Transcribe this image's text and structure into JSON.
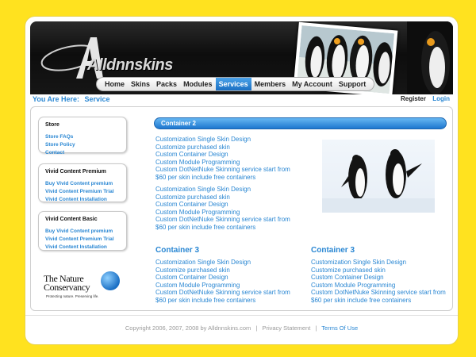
{
  "brand": {
    "logo_text": "Alldnnskins"
  },
  "nav": {
    "items": [
      "Home",
      "Skins",
      "Packs",
      "Modules",
      "Services",
      "Members",
      "My Account",
      "Support"
    ],
    "active": "Services"
  },
  "breadcrumb": {
    "label": "You Are Here:",
    "current": "Service"
  },
  "user": {
    "register": "Register",
    "login": "Login"
  },
  "sidebar": {
    "store": {
      "title": "Store",
      "links": [
        "Store FAQs",
        "Store Policy",
        "Contact"
      ]
    },
    "premium": {
      "title": "Vivid Content Premium",
      "links": [
        "Buy Vivid Content premium",
        "Vivid Content Premium Trial",
        "Vivid Content Installation"
      ]
    },
    "basic": {
      "title": "Vivid Content Basic",
      "links": [
        "Buy Vivid Content premium",
        "Vivid Content Premium Trial",
        "Vivid Content Installation"
      ]
    },
    "nature": {
      "line1": "The Nature",
      "line2": "Conservancy",
      "tagline": "Protecting nature. Preserving life."
    }
  },
  "main": {
    "container2_title": "Container 2",
    "block1": [
      "Customization Single Skin Design",
      "Customize purchased skin",
      "Custom Container Design",
      "Custom Module Programming",
      "Custom DotNetNuke Skinning service start from",
      "$60 per skin include free containers"
    ],
    "block2": [
      "Customization Single Skin Design",
      "Customize purchased skin",
      "Custom Container Design",
      "Custom Module Programming",
      "Custom DotNetNuke Skinning service start from",
      "$60 per skin include free containers"
    ],
    "container3_left_title": "Container 3",
    "block3": [
      "Customization Single Skin Design",
      "Customize purchased skin",
      "Custom Container Design",
      "Custom Module Programming",
      "Custom DotNetNuke Skinning service start from",
      "$60 per skin include free containers"
    ],
    "container3_right_title": "Container 3",
    "block4": [
      "Customization Single Skin Design",
      "Customize purchased skin",
      "Custom Container Design",
      "Custom Module Programming",
      "Custom DotNetNuke Skinning service start from",
      "$60 per skin include free containers"
    ]
  },
  "footer": {
    "copyright": "Copyright 2006, 2007, 2008 by Alldnnskins.com",
    "privacy": "Privacy Statement",
    "terms": "Terms Of Use"
  },
  "colors": {
    "page_bg": "#FFE21F",
    "accent": "#2a87d3",
    "header": "#111111"
  }
}
